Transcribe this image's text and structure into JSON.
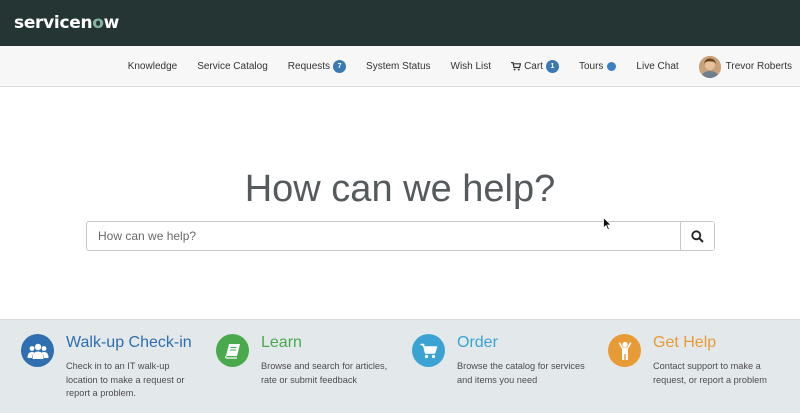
{
  "header": {
    "logo_text_before": "servicen",
    "logo_o": "o",
    "logo_text_after": "w"
  },
  "nav": {
    "knowledge": "Knowledge",
    "service_catalog": "Service Catalog",
    "requests": "Requests",
    "requests_count": "7",
    "system_status": "System Status",
    "wish_list": "Wish List",
    "cart": "Cart",
    "cart_count": "1",
    "tours": "Tours",
    "live_chat": "Live Chat",
    "user_name": "Trevor Roberts"
  },
  "hero": {
    "title": "How can we help?",
    "search_placeholder": "How can we help?"
  },
  "cards": [
    {
      "title": "Walk-up Check-in",
      "text": "Check in to an IT walk-up location to make a request or report a problem.",
      "icon": "users-icon",
      "color": "#2f6eb0"
    },
    {
      "title": "Learn",
      "text": "Browse and search for articles, rate or submit feedback",
      "icon": "book-icon",
      "color": "#4aa84d"
    },
    {
      "title": "Order",
      "text": "Browse the catalog for services and items you need",
      "icon": "cart-icon",
      "color": "#3aa3d3"
    },
    {
      "title": "Get Help",
      "text": "Contact support to make a request, or report a problem",
      "icon": "person-icon",
      "color": "#e89a35"
    }
  ]
}
